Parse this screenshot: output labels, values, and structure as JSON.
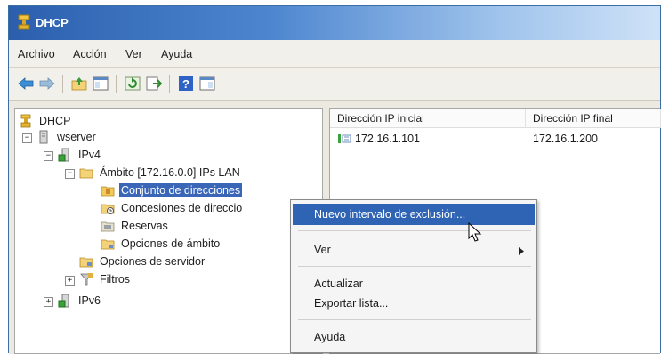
{
  "window": {
    "title": "DHCP"
  },
  "menubar": {
    "items": [
      "Archivo",
      "Acción",
      "Ver",
      "Ayuda"
    ]
  },
  "toolbar": {
    "buttons": [
      "back-arrow-icon",
      "forward-arrow-icon",
      "up-folder-icon",
      "show-hide-tree-icon",
      "refresh-icon",
      "export-list-icon",
      "help-icon",
      "properties-icon"
    ]
  },
  "tree": {
    "root": "DHCP",
    "server": "wserver",
    "ipv4": "IPv4",
    "scope": "Ámbito [172.16.0.0] IPs LAN",
    "address_pool": "Conjunto de direcciones",
    "leases": "Concesiones de direccio",
    "reservations": "Reservas",
    "scope_options": "Opciones de ámbito",
    "server_options": "Opciones de servidor",
    "filters": "Filtros",
    "ipv6": "IPv6"
  },
  "list": {
    "columns": [
      "Dirección IP inicial",
      "Dirección IP final"
    ],
    "rows": [
      {
        "start": "172.16.1.101",
        "end": "172.16.1.200"
      }
    ]
  },
  "context_menu": {
    "items": [
      "Nuevo intervalo de exclusión...",
      "Ver",
      "Actualizar",
      "Exportar lista...",
      "Ayuda"
    ]
  },
  "colors": {
    "title_gradient_start": "#2b5fae",
    "selection": "#3a66b8",
    "menu_highlight": "#2f63b3"
  }
}
